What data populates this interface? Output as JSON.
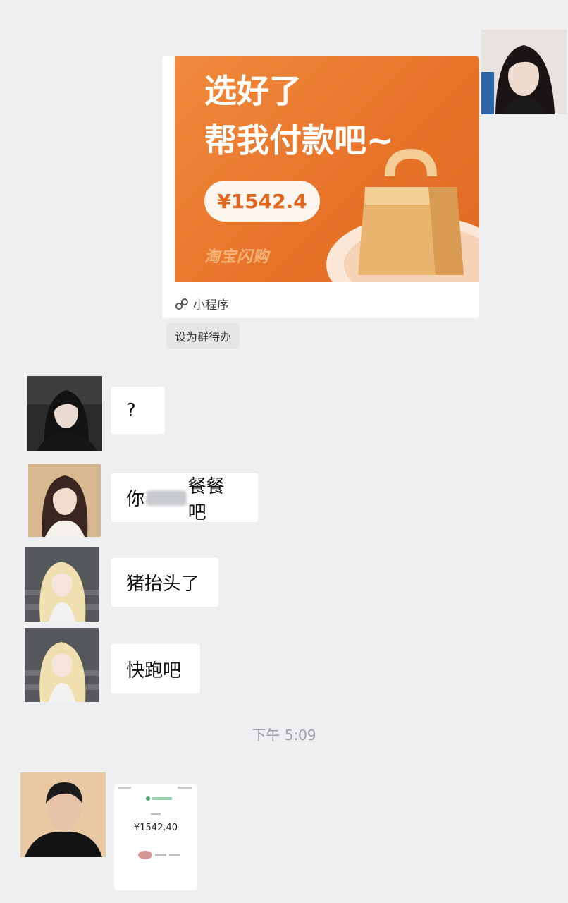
{
  "mini_program_card": {
    "title_line1": "选好了",
    "title_line2": "帮我付款吧~",
    "price": "¥1542.4",
    "brand": "淘宝闪购",
    "footer_label": "小程序"
  },
  "todo_tag": "设为群待办",
  "messages": [
    {
      "text": "?"
    },
    {
      "text_before": "你",
      "text_after": "餐餐吧"
    },
    {
      "text": "猪抬头了"
    },
    {
      "text": "快跑吧"
    }
  ],
  "timestamp": "下午 5:09",
  "payment_screenshot": {
    "amount": "¥1542.40"
  },
  "colors": {
    "background": "#edeff0",
    "banner_orange": "#e8742a",
    "bubble": "#ffffff"
  }
}
